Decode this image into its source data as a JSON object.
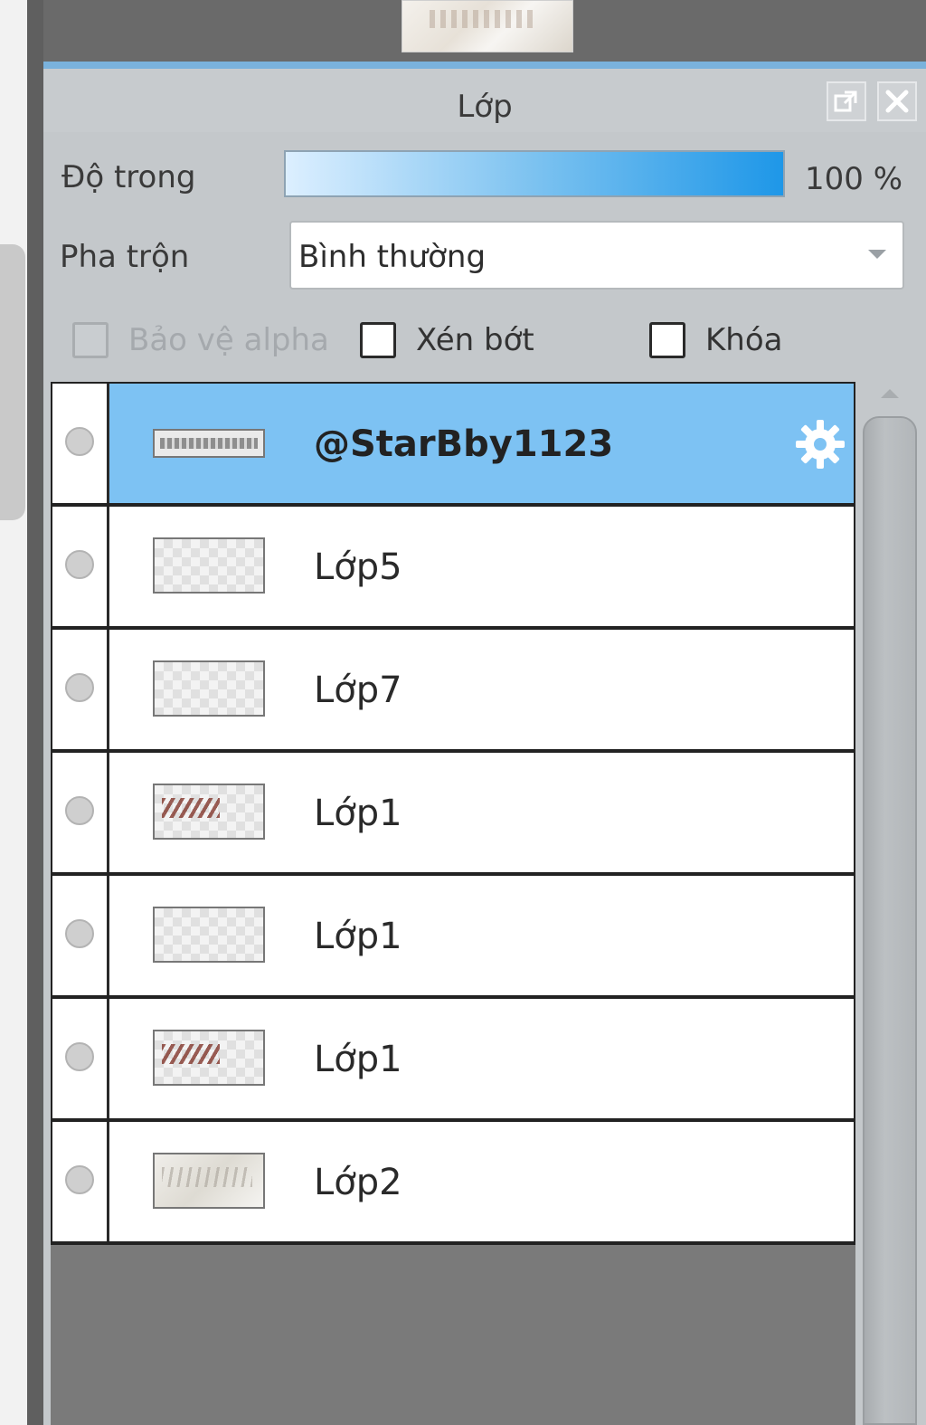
{
  "panel": {
    "title": "Lớp"
  },
  "opacity": {
    "label": "Độ trong",
    "value_text": "100 %",
    "value": 100
  },
  "blend": {
    "label": "Pha trộn",
    "selected": "Bình thường"
  },
  "options": {
    "protect_alpha": {
      "label": "Bảo vệ alpha",
      "checked": false,
      "enabled": false
    },
    "clip": {
      "label": "Xén bớt",
      "checked": false
    },
    "lock": {
      "label": "Khóa",
      "checked": false
    }
  },
  "layers": [
    {
      "name": "@StarBby1123",
      "selected": true,
      "thumb": "text-thumb"
    },
    {
      "name": "Lớp5",
      "selected": false,
      "thumb": "transparent"
    },
    {
      "name": "Lớp7",
      "selected": false,
      "thumb": "transparent"
    },
    {
      "name": "Lớp1",
      "selected": false,
      "thumb": "ink"
    },
    {
      "name": "Lớp1",
      "selected": false,
      "thumb": "transparent"
    },
    {
      "name": "Lớp1",
      "selected": false,
      "thumb": "ink"
    },
    {
      "name": "Lớp2",
      "selected": false,
      "thumb": "photo"
    }
  ],
  "icons": {
    "popout": "popout-icon",
    "close": "close-icon",
    "settings": "gear-icon",
    "visibility": "visibility-dot-icon",
    "dropdown": "chevron-down-icon"
  },
  "colors": {
    "selected_row": "#7dc2f3",
    "opacity_bar_end": "#1e97e8",
    "panel_bg": "#c4c8cb"
  }
}
